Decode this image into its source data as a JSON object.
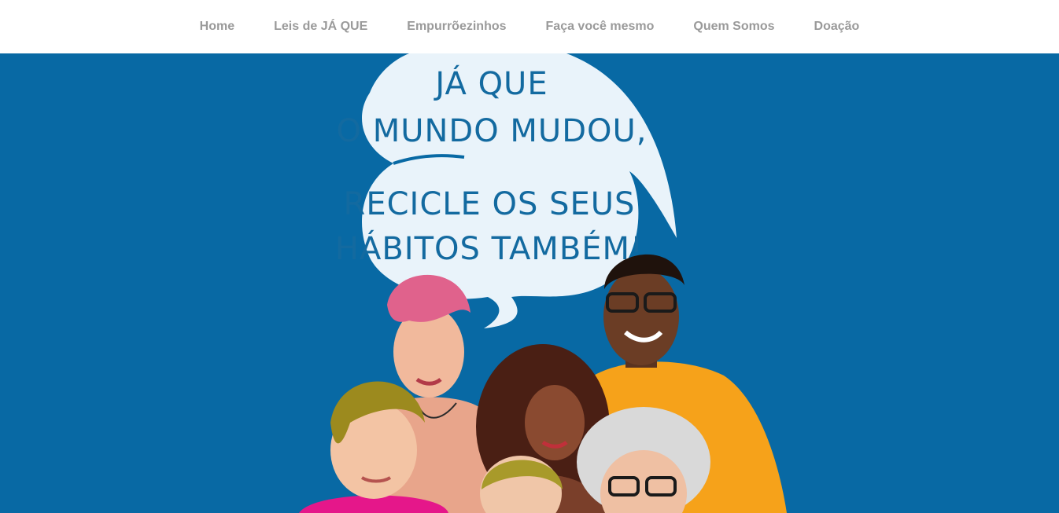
{
  "nav": {
    "items": [
      {
        "label": "Home"
      },
      {
        "label": "Leis de JÁ QUE"
      },
      {
        "label": "Empurrõezinhos"
      },
      {
        "label": "Faça você mesmo"
      },
      {
        "label": "Quem Somos"
      },
      {
        "label": "Doação"
      }
    ]
  },
  "hero": {
    "bubble_top_line1": "JÁ QUE",
    "bubble_top_line2": "O MUNDO MUDOU,",
    "bubble_bottom_line1": "RECICLE OS SEUS",
    "bubble_bottom_line2": "HÁBITOS TAMBÉM!",
    "background_color": "#0869a4"
  }
}
